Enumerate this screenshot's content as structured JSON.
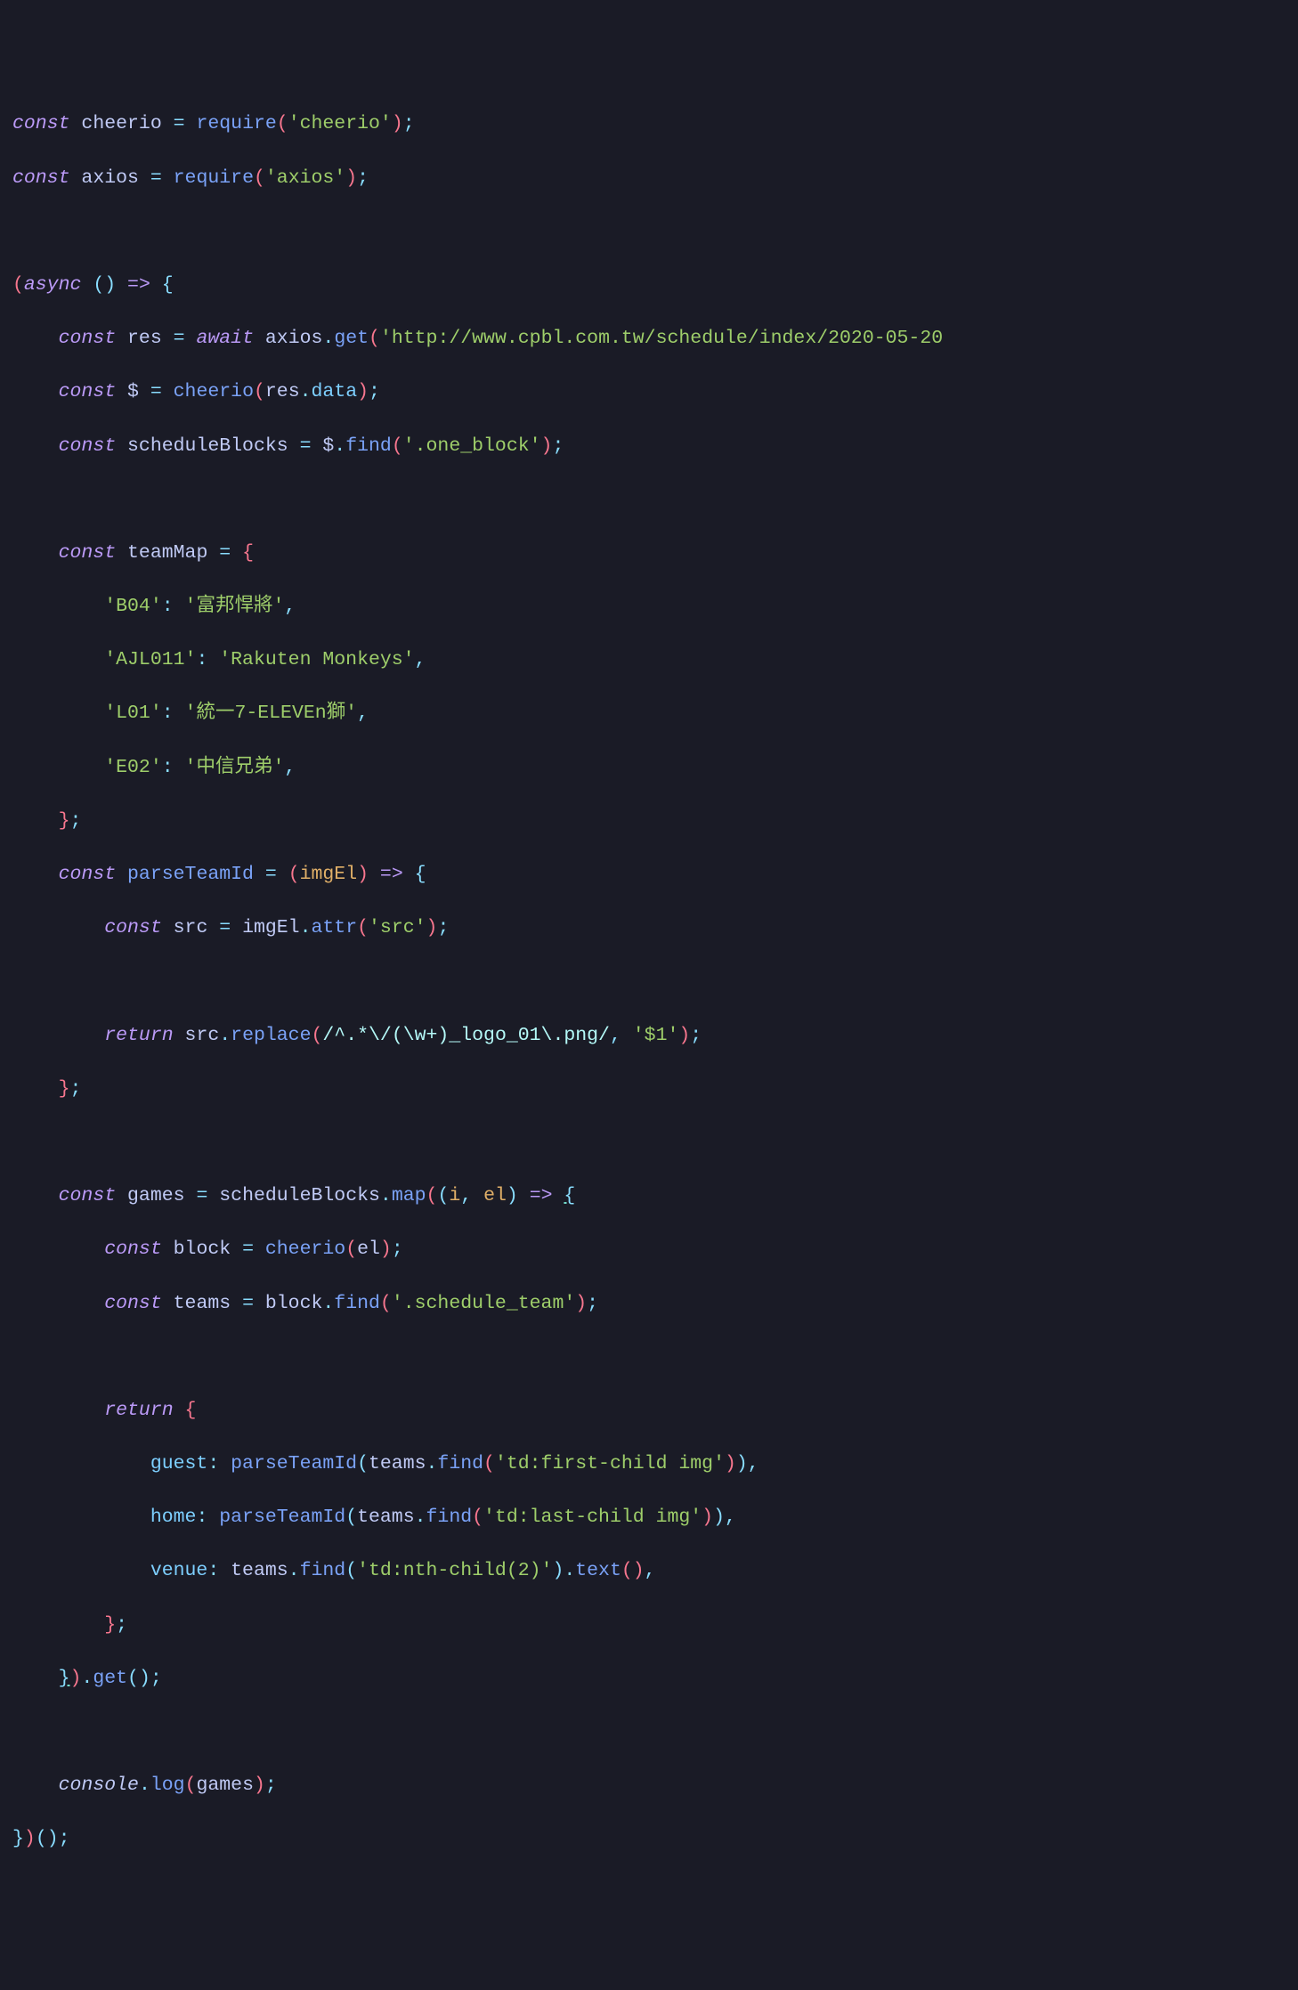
{
  "colors": {
    "background": "#1a1b26",
    "keyword": "#bb9af7",
    "variable": "#c0caf5",
    "function": "#7aa2f7",
    "string": "#9ece6a",
    "parameter": "#e0af68",
    "property": "#7dcfff",
    "operator": "#89ddff",
    "paren": "#f7768e",
    "regex": "#b4f9f8"
  },
  "code": {
    "l1": {
      "kw": "const",
      "var": "cheerio",
      "eq": "=",
      "fn": "require",
      "str": "'cheerio'",
      "paren_o": "(",
      "paren_c": ")",
      "semi": ";"
    },
    "l2": {
      "kw": "const",
      "var": "axios",
      "eq": "=",
      "fn": "require",
      "str": "'axios'",
      "paren_o": "(",
      "paren_c": ")",
      "semi": ";"
    },
    "l4": {
      "paren_o": "(",
      "async": "async",
      "paren2_o": "(",
      "paren2_c": ")",
      "arrow": "=>",
      "brace": "{"
    },
    "l5": {
      "indent": "    ",
      "kw": "const",
      "var": "res",
      "eq": "=",
      "await": "await",
      "obj": "axios",
      "dot": ".",
      "method": "get",
      "paren_o": "(",
      "str": "'http://www.cpbl.com.tw/schedule/index/2020-05-20"
    },
    "l6": {
      "indent": "    ",
      "kw": "const",
      "var": "$",
      "eq": "=",
      "fn": "cheerio",
      "paren_o": "(",
      "arg": "res",
      "dot": ".",
      "prop": "data",
      "paren_c": ")",
      "semi": ";"
    },
    "l7": {
      "indent": "    ",
      "kw": "const",
      "var": "scheduleBlocks",
      "eq": "=",
      "obj": "$",
      "dot": ".",
      "method": "find",
      "paren_o": "(",
      "str": "'.one_block'",
      "paren_c": ")",
      "semi": ";"
    },
    "l9": {
      "indent": "    ",
      "kw": "const",
      "var": "teamMap",
      "eq": "=",
      "brace": "{"
    },
    "l10": {
      "indent": "        ",
      "key": "'B04'",
      "colon": ":",
      "val": "'富邦悍將'",
      "comma": ","
    },
    "l11": {
      "indent": "        ",
      "key": "'AJL011'",
      "colon": ":",
      "val": "'Rakuten Monkeys'",
      "comma": ","
    },
    "l12": {
      "indent": "        ",
      "key": "'L01'",
      "colon": ":",
      "val": "'統一7-ELEVEn獅'",
      "comma": ","
    },
    "l13": {
      "indent": "        ",
      "key": "'E02'",
      "colon": ":",
      "val": "'中信兄弟'",
      "comma": ","
    },
    "l14": {
      "indent": "    ",
      "brace": "}",
      "semi": ";"
    },
    "l15": {
      "indent": "    ",
      "kw": "const",
      "var": "parseTeamId",
      "eq": "=",
      "paren_o": "(",
      "param": "imgEl",
      "paren_c": ")",
      "arrow": "=>",
      "brace": "{"
    },
    "l16": {
      "indent": "        ",
      "kw": "const",
      "var": "src",
      "eq": "=",
      "obj": "imgEl",
      "dot": ".",
      "method": "attr",
      "paren_o": "(",
      "str": "'src'",
      "paren_c": ")",
      "semi": ";"
    },
    "l18": {
      "indent": "        ",
      "kw": "return",
      "obj": "src",
      "dot": ".",
      "method": "replace",
      "paren_o": "(",
      "regex": "/^.*\\/(\\w+)_logo_01\\.png/",
      "comma": ",",
      "str": "'$1'",
      "paren_c": ")",
      "semi": ";"
    },
    "l19": {
      "indent": "    ",
      "brace": "}",
      "semi": ";"
    },
    "l21": {
      "indent": "    ",
      "kw": "const",
      "var": "games",
      "eq": "=",
      "obj": "scheduleBlocks",
      "dot": ".",
      "method": "map",
      "paren_o": "(",
      "paren2_o": "(",
      "param1": "i",
      "comma": ",",
      "param2": "el",
      "paren2_c": ")",
      "arrow": "=>",
      "brace": "{"
    },
    "l22": {
      "indent": "        ",
      "kw": "const",
      "var": "block",
      "eq": "=",
      "fn": "cheerio",
      "paren_o": "(",
      "arg": "el",
      "paren_c": ")",
      "semi": ";"
    },
    "l23": {
      "indent": "        ",
      "kw": "const",
      "var": "teams",
      "eq": "=",
      "obj": "block",
      "dot": ".",
      "method": "find",
      "paren_o": "(",
      "str": "'.schedule_team'",
      "paren_c": ")",
      "semi": ";"
    },
    "l25": {
      "indent": "        ",
      "kw": "return",
      "brace": "{"
    },
    "l26": {
      "indent": "            ",
      "key": "guest",
      "colon": ":",
      "fn": "parseTeamId",
      "paren_o": "(",
      "obj": "teams",
      "dot": ".",
      "method": "find",
      "paren2_o": "(",
      "str": "'td:first-child img'",
      "paren2_c": ")",
      "paren_c": ")",
      "comma": ","
    },
    "l27": {
      "indent": "            ",
      "key": "home",
      "colon": ":",
      "fn": "parseTeamId",
      "paren_o": "(",
      "obj": "teams",
      "dot": ".",
      "method": "find",
      "paren2_o": "(",
      "str": "'td:last-child img'",
      "paren2_c": ")",
      "paren_c": ")",
      "comma": ","
    },
    "l28": {
      "indent": "            ",
      "key": "venue",
      "colon": ":",
      "obj": "teams",
      "dot": ".",
      "method": "find",
      "paren_o": "(",
      "str": "'td:nth-child(2)'",
      "paren_c": ")",
      "dot2": ".",
      "method2": "text",
      "paren2_o": "(",
      "paren2_c": ")",
      "comma": ","
    },
    "l29": {
      "indent": "        ",
      "brace": "}",
      "semi": ";"
    },
    "l30": {
      "indent": "    ",
      "brace": "}",
      "paren_c": ")",
      "dot": ".",
      "method": "get",
      "paren2_o": "(",
      "paren2_c": ")",
      "semi": ";"
    },
    "l32": {
      "indent": "    ",
      "obj": "console",
      "dot": ".",
      "method": "log",
      "paren_o": "(",
      "arg": "games",
      "paren_c": ")",
      "semi": ";"
    },
    "l33": {
      "brace": "}",
      "paren_c": ")",
      "paren2_o": "(",
      "paren2_c": ")",
      "semi": ";"
    }
  }
}
